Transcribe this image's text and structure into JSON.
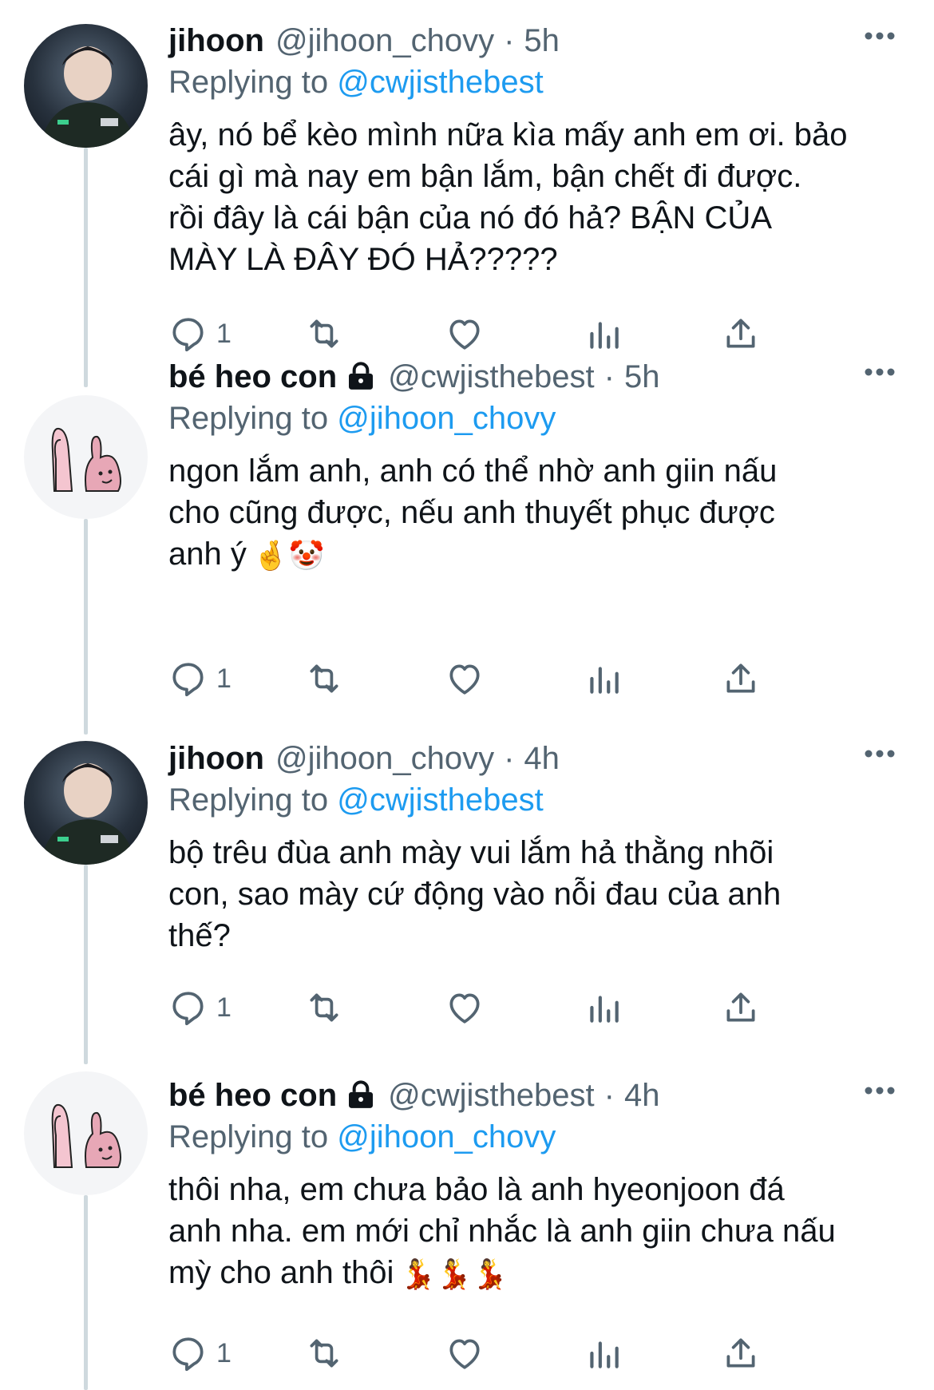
{
  "tweets": [
    {
      "name": "jihoon",
      "handle": "@jihoon_chovy",
      "time": "5h",
      "locked": false,
      "reply_prefix": "Replying to ",
      "reply_to": "@cwjisthebest",
      "text": "ây, nó bể kèo mình nữa kìa mấy anh em ơi. bảo\ncái gì mà nay em bận lắm, bận chết đi được.\nrồi đây là cái bận của nó đó hả? BẬN CỦA\nMÀY LÀ ĐÂY ĐÓ HẢ?????",
      "emoji": "",
      "replies": "1",
      "avatar": "jihoon-photo-avatar"
    },
    {
      "name": "bé heo con",
      "handle": "@cwjisthebest",
      "time": "5h",
      "locked": true,
      "reply_prefix": "Replying to ",
      "reply_to": "@jihoon_chovy",
      "text": "ngon lắm anh, anh có thể nhờ anh giin nấu\ncho cũng được, nếu anh thuyết phục được\nanh ý",
      "emoji": "🤞🤡",
      "replies": "1",
      "avatar": "bunny-cartoon-avatar"
    },
    {
      "name": "jihoon",
      "handle": "@jihoon_chovy",
      "time": "4h",
      "locked": false,
      "reply_prefix": "Replying to ",
      "reply_to": "@cwjisthebest",
      "text": "bộ trêu đùa anh mày vui lắm hả thằng nhõi\ncon, sao mày cứ động vào nỗi đau của anh\nthế?",
      "emoji": "",
      "replies": "1",
      "avatar": "jihoon-photo-avatar"
    },
    {
      "name": "bé heo con",
      "handle": "@cwjisthebest",
      "time": "4h",
      "locked": true,
      "reply_prefix": "Replying to ",
      "reply_to": "@jihoon_chovy",
      "text": "thôi nha, em chưa bảo là anh hyeonjoon đá\nanh nha. em mới chỉ nhắc là anh giin chưa nấu\nmỳ cho anh thôi",
      "emoji": "💃💃💃",
      "replies": "1",
      "avatar": "bunny-cartoon-avatar"
    }
  ],
  "colors": {
    "text": "#0f1419",
    "secondary": "#536471",
    "link": "#1d9bf0",
    "thread_line": "#cfd9de"
  },
  "icons": [
    "reply-icon",
    "retweet-icon",
    "like-icon",
    "analytics-icon",
    "share-icon",
    "more-icon",
    "lock-icon"
  ]
}
